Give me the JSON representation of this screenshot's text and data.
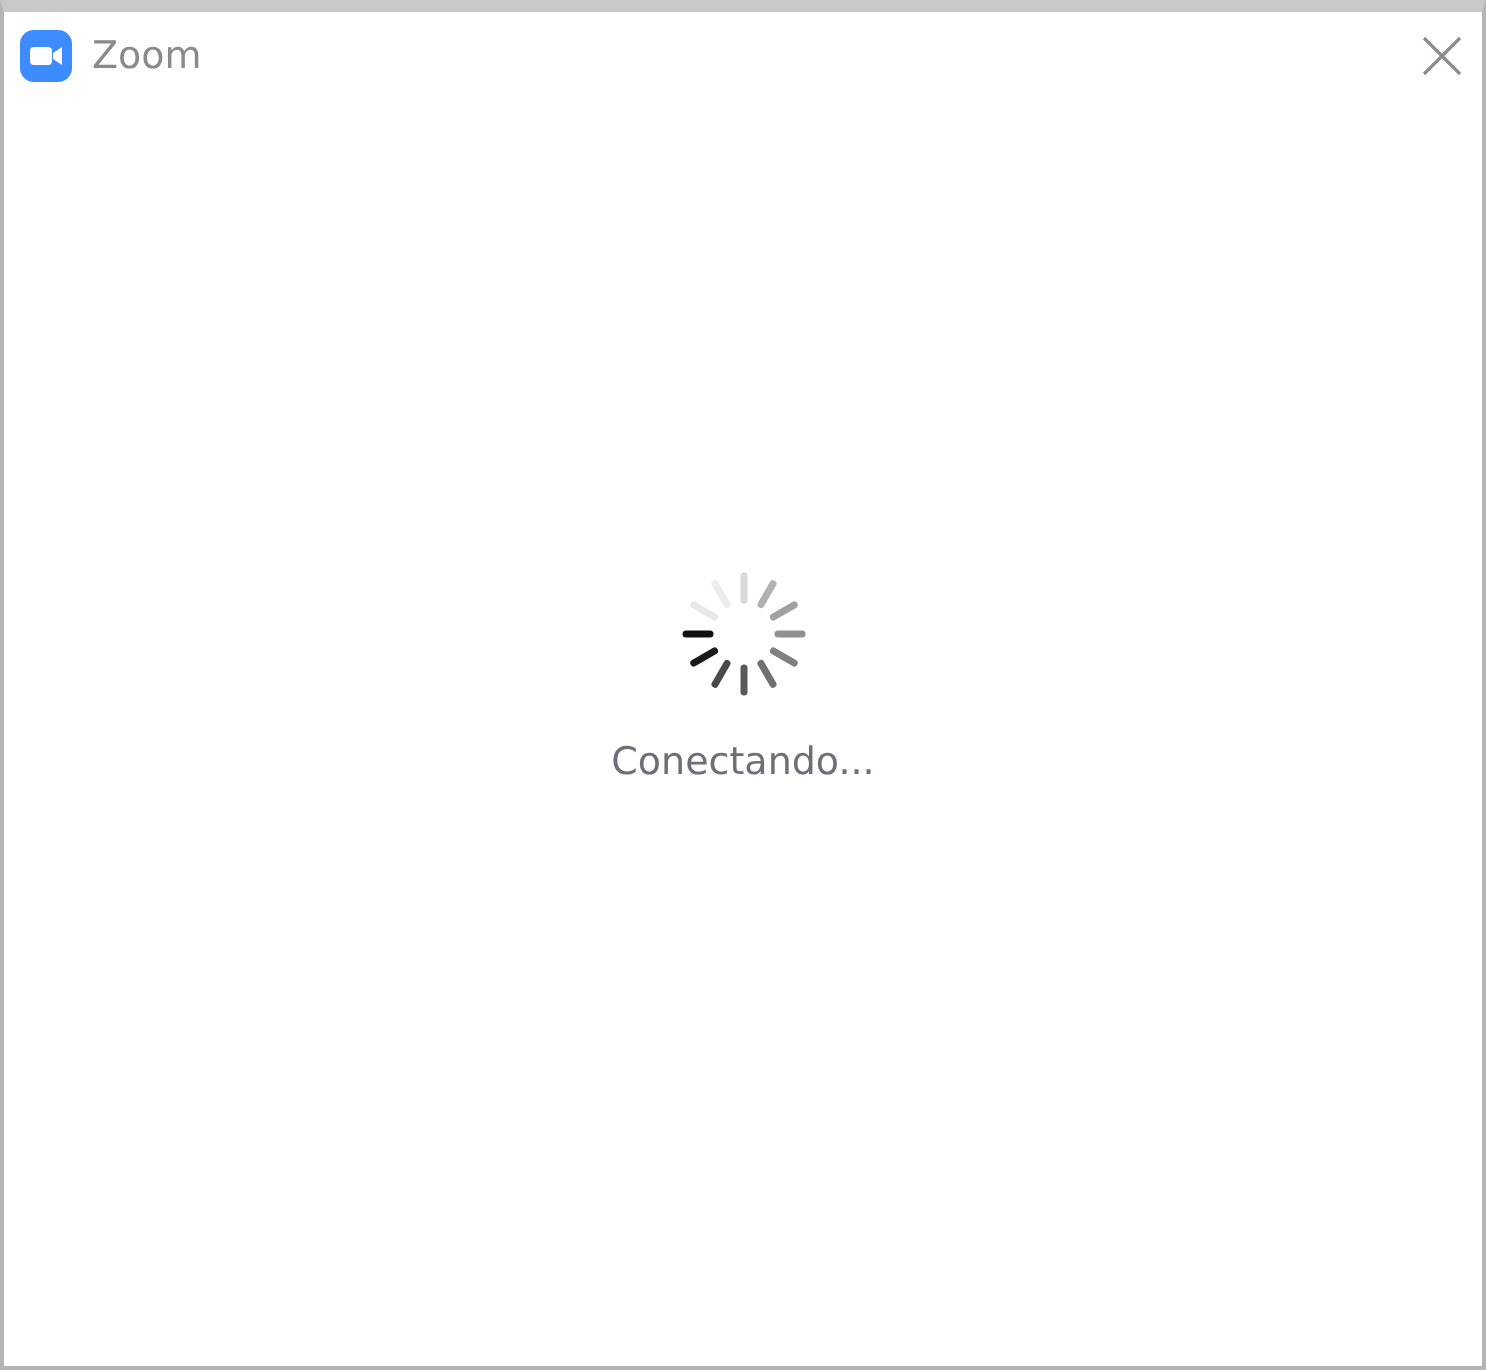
{
  "window": {
    "title": "Zoom"
  },
  "status": {
    "message": "Conectando..."
  }
}
